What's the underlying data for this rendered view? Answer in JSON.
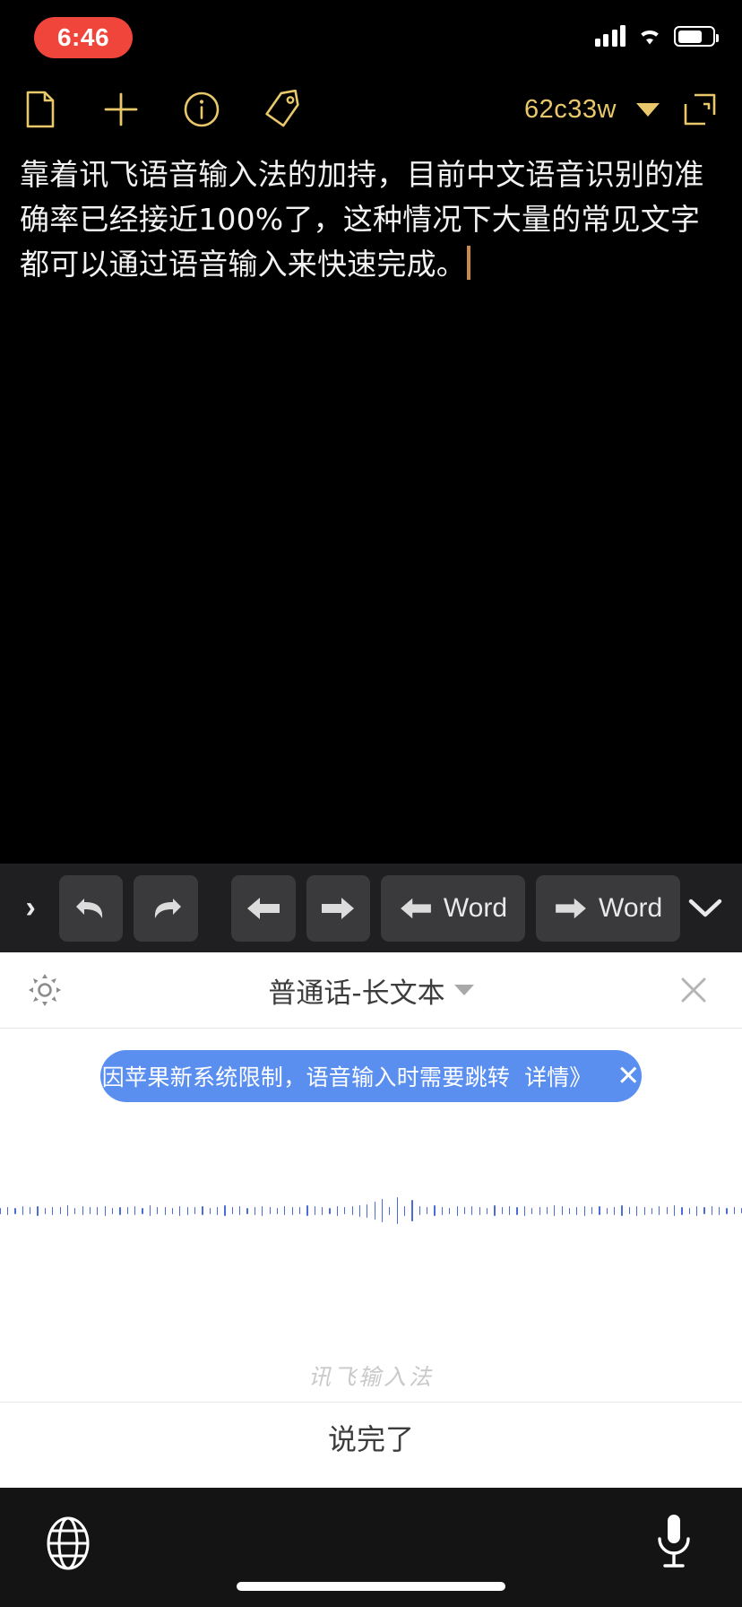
{
  "status_bar": {
    "time": "6:46",
    "time_pill_color": "#F0453A",
    "icons": [
      "cellular-signal-icon",
      "wifi-icon",
      "battery-icon"
    ],
    "battery_level_pct": 63
  },
  "app_toolbar": {
    "accent_color": "#E8C86A",
    "left_icons": [
      {
        "name": "new-document-icon",
        "label": "New Document"
      },
      {
        "name": "add-icon",
        "label": "Add"
      },
      {
        "name": "info-icon",
        "label": "Info"
      },
      {
        "name": "tag-icon",
        "label": "Tag"
      }
    ],
    "document_name": "62c33w",
    "dropdown_icon": "chevron-down-icon",
    "expand_icon": "expand-window-icon"
  },
  "editor": {
    "text": "靠着讯飞语音输入法的加持，目前中文语音识别的准确率已经接近100%了，这种情况下大量的常见文字都可以通过语音输入来快速完成。",
    "text_color": "#F2F2F2",
    "caret_color": "#C98A45"
  },
  "edit_toolbar": {
    "background": "#1F1F21",
    "button_background": "#3A3A3C",
    "expand_chevron": "›",
    "buttons": [
      {
        "name": "undo-button",
        "icon": "undo-icon",
        "label": ""
      },
      {
        "name": "redo-button",
        "icon": "redo-icon",
        "label": ""
      },
      {
        "name": "cursor-left-button",
        "icon": "arrow-left-icon",
        "label": ""
      },
      {
        "name": "cursor-right-button",
        "icon": "arrow-right-icon",
        "label": ""
      },
      {
        "name": "word-left-button",
        "icon": "arrow-left-icon",
        "label": "Word"
      },
      {
        "name": "word-right-button",
        "icon": "arrow-right-icon",
        "label": "Word"
      }
    ],
    "word_left_label": "Word",
    "word_right_label": "Word",
    "collapse_icon": "chevron-down-icon"
  },
  "ime": {
    "gear_icon": "gear-icon",
    "title": "普通话-长文本",
    "title_dropdown_icon": "triangle-down-icon",
    "close_icon": "close-icon",
    "banner": {
      "text": "因苹果新系统限制，语音输入时需要跳转",
      "link": "详情》",
      "close": "✕",
      "background": "#5A8FF0"
    },
    "waveform": {
      "bar_color": "#4B6BD6",
      "heights": [
        7,
        9,
        7,
        10,
        8,
        11,
        7,
        9,
        8,
        12,
        7,
        10,
        8,
        9,
        11,
        7,
        9,
        8,
        10,
        7,
        12,
        8,
        9,
        7,
        11,
        9,
        8,
        10,
        7,
        9,
        12,
        8,
        10,
        7,
        9,
        11,
        8,
        7,
        10,
        9,
        8,
        12,
        10,
        9,
        7,
        11,
        8,
        10,
        13,
        15,
        20,
        26,
        9,
        30,
        11,
        24,
        10,
        8,
        12,
        9,
        7,
        11,
        8,
        10,
        9,
        7,
        12,
        8,
        10,
        9,
        11,
        7,
        9,
        8,
        12,
        10,
        7,
        9,
        11,
        8,
        10,
        7,
        9,
        12,
        8,
        11,
        9,
        7,
        10,
        8,
        12,
        9,
        7,
        11,
        8,
        10,
        9,
        7,
        8,
        6
      ]
    },
    "watermark": "讯飞输入法",
    "done_label": "说完了"
  },
  "bottom_bar": {
    "background": "#141414",
    "globe_icon": "globe-icon",
    "mic_icon": "microphone-icon",
    "home_indicator": "home-indicator"
  }
}
